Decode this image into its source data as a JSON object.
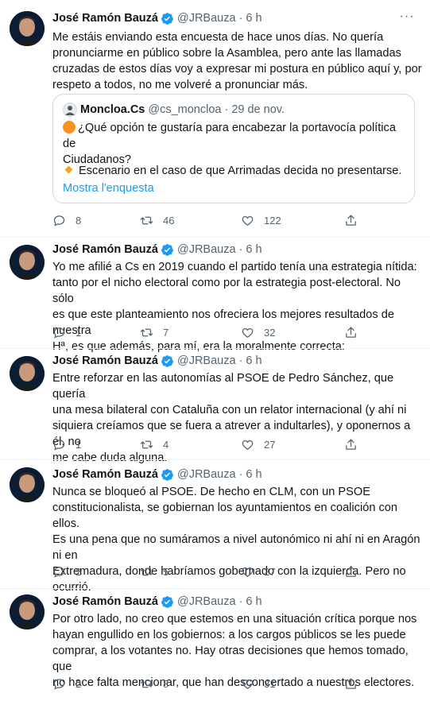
{
  "tweets": [
    {
      "author": "José Ramón Bauzá",
      "handle": "@JRBauza",
      "dot": "·",
      "time": "6 h",
      "lines": [
        "Me estáis enviando esta encuesta de hace unos días. No quería",
        "pronunciarme en público sobre la Asamblea, pero ante las llamadas",
        "cruzadas de estos días voy a expresar mi postura en público aquí y, por",
        "respeto a todos, no me volveré a pronunciar más."
      ],
      "replies": "8",
      "retweets": "46",
      "likes": "122"
    },
    {
      "author": "José Ramón Bauzá",
      "handle": "@JRBauza",
      "dot": "·",
      "time": "6 h",
      "lines": [
        "Yo me afilié a Cs en 2019 cuando el partido tenía una estrategia nítida:",
        "tanto por el nicho electoral como por la estrategia post-electoral. No sólo",
        "es que este planteamiento nos ofreciera los mejores resultados de nuestra",
        "Hª, es que además, para mí, era la moralmente correcta:"
      ],
      "replies": "1",
      "retweets": "7",
      "likes": "32"
    },
    {
      "author": "José Ramón Bauzá",
      "handle": "@JRBauza",
      "dot": "·",
      "time": "6 h",
      "lines": [
        "Entre reforzar en las autonomías al PSOE de Pedro Sánchez, que quería",
        "una mesa bilateral con Cataluña con un relator internacional (y ahí ni",
        "siquiera creíamos que se fuera a atrever a indultarles), y oponernos a él, no",
        "me cabe duda alguna."
      ],
      "replies": "1",
      "retweets": "4",
      "likes": "27"
    },
    {
      "author": "José Ramón Bauzá",
      "handle": "@JRBauza",
      "dot": "·",
      "time": "6 h",
      "lines": [
        "Nunca se bloqueó al PSOE. De hecho en CLM, con un PSOE",
        "constitucionalista, se gobiernan los ayuntamientos en coalición con ellos.",
        "Es una pena que no sumáramos a nivel autonómico ni ahí ni en Aragón ni en",
        "Extremadura, donde habríamos gobernado con la izquierda. Pero no",
        "ocurrió."
      ],
      "replies": "2",
      "retweets": "5",
      "likes": "27"
    },
    {
      "author": "José Ramón Bauzá",
      "handle": "@JRBauza",
      "dot": "·",
      "time": "6 h",
      "lines": [
        "Por otro lado, no creo que estemos en una situación crítica porque nos",
        "hayan engullido en los gobiernos: a los cargos públicos se les puede",
        "comprar, a los votantes no. Hay otras decisiones que hemos tomado, que",
        "no hace falta mencionar, que han desconcertado a nuestros electores."
      ],
      "replies": "2",
      "retweets": "8",
      "likes": "31"
    }
  ],
  "quote": {
    "author": "Moncloa.Cs",
    "handle": "@cs_moncloa",
    "dot": "·",
    "date": "29 de nov.",
    "question_lines": [
      "¿Qué opción te gustaría para encabezar la portavocía política de",
      "Ciudadanos?"
    ],
    "option": "Escenario en el caso de que Arrimadas decida no presentarse.",
    "link": "Mostra l'enquesta"
  },
  "icons": {
    "reply": "reply-icon",
    "retweet": "retweet-icon",
    "like": "heart-icon",
    "share": "share-icon",
    "more": "more-icon",
    "verified": "verified-badge-icon"
  },
  "colors": {
    "accent": "#1d9bf0",
    "muted": "#536471",
    "poll_orange": "#f7931e"
  }
}
